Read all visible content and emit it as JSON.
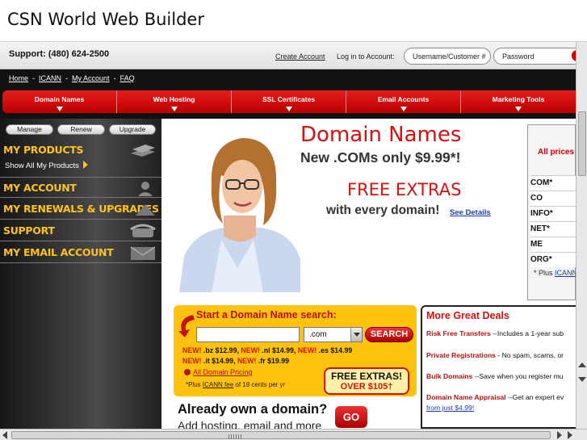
{
  "window": {
    "title": "CSN World Web Builder"
  },
  "support": {
    "phone_text": "Support: (480) 624-2500",
    "create_account": "Create Account",
    "login_label": "Log in to Account:",
    "username_placeholder": "Username/Customer #",
    "password_placeholder": "Password"
  },
  "toplinks": {
    "home": "Home",
    "icann": "ICANN",
    "my_account": "My Account",
    "faq": "FAQ",
    "separator": "-"
  },
  "tabs": [
    {
      "label": "Domain Names"
    },
    {
      "label": "Web Hosting"
    },
    {
      "label": "SSL Certificates"
    },
    {
      "label": "Email Accounts"
    },
    {
      "label": "Marketing Tools"
    }
  ],
  "sidebar": {
    "buttons": {
      "manage": "Manage",
      "renew": "Renew",
      "upgrade": "Upgrade"
    },
    "sections": [
      {
        "label": "MY PRODUCTS",
        "icon": "server-icon"
      },
      {
        "label": "MY ACCOUNT",
        "icon": "person-icon"
      },
      {
        "label": "MY RENEWALS & UPGRADES",
        "icon": "renew-icon"
      },
      {
        "label": "SUPPORT",
        "icon": "phone-icon"
      },
      {
        "label": "MY EMAIL ACCOUNT",
        "icon": "envelope-icon"
      }
    ],
    "show_all": "Show All My Products"
  },
  "hero": {
    "title": "Domain Names",
    "subtitle": "New .COMs only $9.99*!",
    "free_title": "FREE EXTRAS",
    "free_sub": "with every domain!",
    "see_details": "See Details"
  },
  "prices": {
    "header": "All prices",
    "rows": [
      "COM*",
      "CO",
      "INFO*",
      "NET*",
      "ME",
      "ORG*"
    ],
    "plus": "* Plus",
    "icann": "ICANN"
  },
  "search": {
    "title": "Start a Domain Name search:",
    "input_value": "",
    "tld": ".com",
    "button": "SEARCH",
    "promo_lines": [
      [
        {
          "new": "NEW!",
          "text": " .bz $12.99, "
        },
        {
          "new": "NEW!",
          "text": " .nl $14.99, "
        },
        {
          "new": "NEW!",
          "text": " .es $14.99"
        }
      ],
      [
        {
          "new": "NEW!",
          "text": " .it $14.99, "
        },
        {
          "new": "NEW!",
          "text": " .fr $19.99"
        }
      ]
    ],
    "all_pricing": "All Domain Pricing",
    "plus_prefix": "*Plus",
    "icann_fee": "ICANN fee",
    "plus_suffix": "of 18 cents per yr",
    "free_box_title": "FREE EXTRAS!",
    "free_box_sub": "OVER $105†"
  },
  "deals": {
    "title": "More Great Deals",
    "items": [
      {
        "name": "Risk Free Transfers",
        "text": " --Includes a 1-year sub"
      },
      {
        "name": "Private Registrations",
        "text": " - No spam, scams, or"
      },
      {
        "name": "Bulk Domains",
        "text": " --Save when you register mu"
      },
      {
        "name": "Domain Name Appraisal",
        "text": " --Get an expert ev"
      }
    ],
    "from": "from just $4.99!"
  },
  "already": {
    "title": "Already own a domain?",
    "sub": "Add hosting, email and more",
    "go": "GO"
  },
  "colors": {
    "brand_red": "#d41010",
    "accent_yellow": "#ffc20e",
    "link_blue": "#1c3fa8"
  }
}
